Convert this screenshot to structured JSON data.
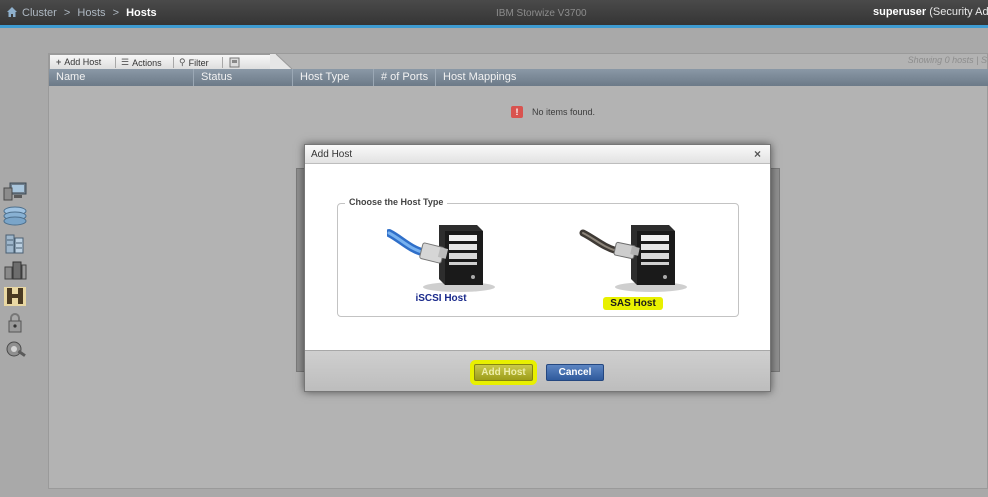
{
  "topbar": {
    "breadcrumb": [
      "Cluster",
      "Hosts",
      "Hosts"
    ],
    "product": "IBM Storwize V3700",
    "user": "superuser",
    "role": "(Security Admi"
  },
  "toolbar": {
    "add_host": "Add Host",
    "actions": "Actions",
    "filter": "Filter",
    "showing": "Showing 0 hosts | S"
  },
  "grid": {
    "columns": [
      "Name",
      "Status",
      "Host Type",
      "# of Ports",
      "Host Mappings"
    ],
    "empty_message": "No items found."
  },
  "leftnav": {
    "icons": [
      "monitoring-icon",
      "pools-icon",
      "volumes-icon",
      "hosts-icon",
      "copy-services-icon",
      "access-icon",
      "settings-icon"
    ]
  },
  "dialog": {
    "title": "Add Host",
    "close": "×",
    "legend": "Choose the Host Type",
    "options": [
      {
        "label": "iSCSI Host",
        "cable_color": "#3b7fd6"
      },
      {
        "label": "SAS Host",
        "cable_color": "#4a4540",
        "highlight": "#e8f000"
      }
    ],
    "add_button": "Add Host",
    "cancel_button": "Cancel"
  },
  "colors": {
    "topbar_accent": "#3e9bd1",
    "cancel_button": "#3a66aa",
    "highlight": "#e8f000"
  }
}
